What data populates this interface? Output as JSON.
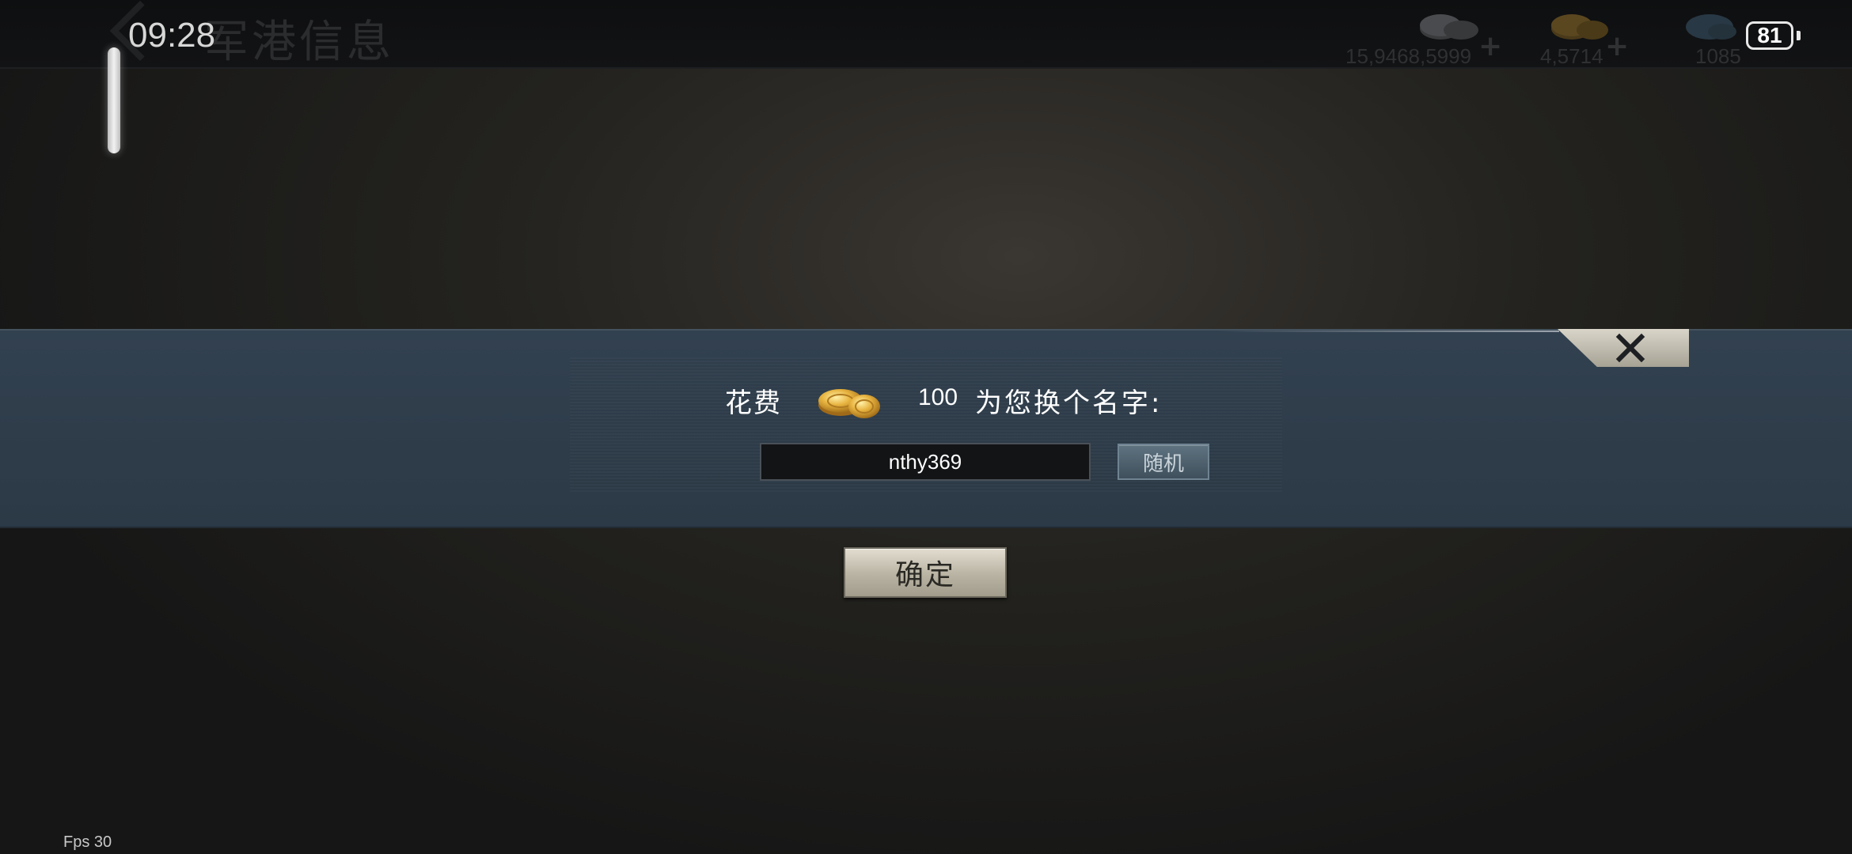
{
  "status_bar": {
    "time": "09:28",
    "battery": "81"
  },
  "header": {
    "title": "军港信息"
  },
  "resources": {
    "silver": {
      "value": "15,9468,5999",
      "plus": "+"
    },
    "gold": {
      "value": "4,5714",
      "plus": "+"
    },
    "gems": {
      "value": "1085"
    }
  },
  "dialog": {
    "cost_prefix": "花费",
    "cost_amount": "100",
    "cost_suffix": "为您换个名字:",
    "name_value": "nthy369",
    "random_label": "随机",
    "confirm_label": "确定"
  },
  "footer": {
    "fps": "Fps 30"
  },
  "colors": {
    "panel": "#2f3d4a",
    "confirm": "#c9c4b6",
    "random": "#4f626f"
  }
}
